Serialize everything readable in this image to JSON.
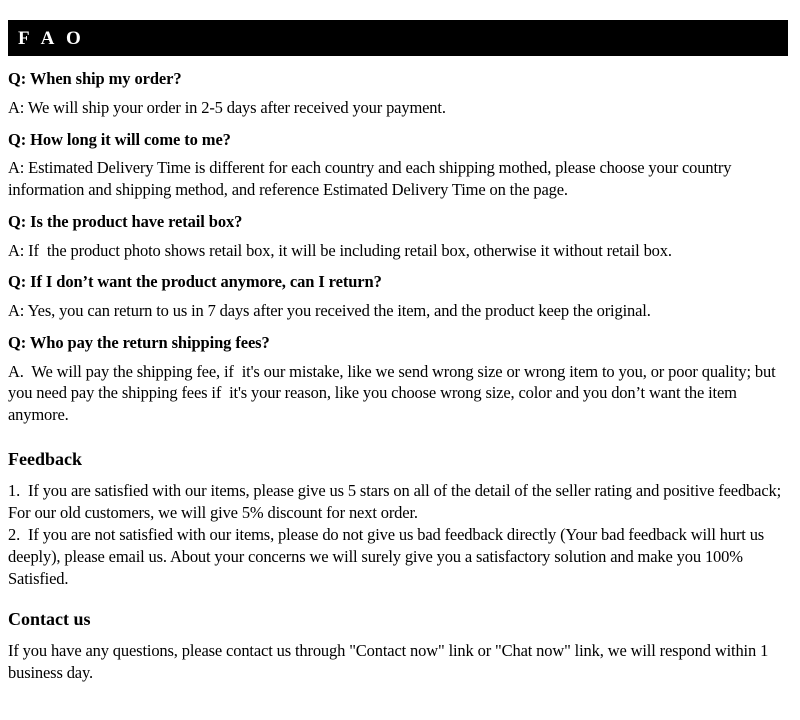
{
  "header": {
    "title": "F A O",
    "background_color": "#000000",
    "text_color": "#ffffff"
  },
  "faq": {
    "items": [
      {
        "question": "Q: When ship my order?",
        "answer": "A: We will ship your order in 2-5 days after received your payment."
      },
      {
        "question": "Q: How long it will come to me?",
        "answer": "A: Estimated Delivery Time is different for each country and each shipping mothed, please choose your country information and shipping method, and reference Estimated Delivery Time on the page."
      },
      {
        "question": "Q: Is the product have retail box?",
        "answer": "A: If  the product photo shows retail box, it will be including retail box, otherwise it without retail box."
      },
      {
        "question": "Q: If  I don’t want the product anymore, can I return?",
        "answer": "A: Yes, you can return to us in 7 days after you received the item, and the product keep the original."
      },
      {
        "question": "Q: Who pay the return shipping fees?",
        "answer": "A.  We will pay the shipping fee, if  it's our mistake, like we send wrong size or wrong item to you, or poor quality; but you need pay the shipping fees if  it's your reason, like you choose wrong size, color and you don’t want the item anymore."
      }
    ]
  },
  "feedback": {
    "heading": "Feedback",
    "items": [
      "1.  If you are satisfied with our items, please give us 5 stars on all of the detail of the seller rating and positive feedback; For our old customers, we will give 5% discount for next order.",
      "2.  If you are not satisfied with our items, please do not give us bad feedback directly (Your bad feedback will hurt us deeply), please email us. About your concerns we will surely give you a satisfactory solution and make you 100% Satisfied."
    ]
  },
  "contact": {
    "heading": "Contact us",
    "body": "If you have any questions, please contact us through \"Contact now\" link or \"Chat now\" link, we will respond within 1 business day."
  }
}
